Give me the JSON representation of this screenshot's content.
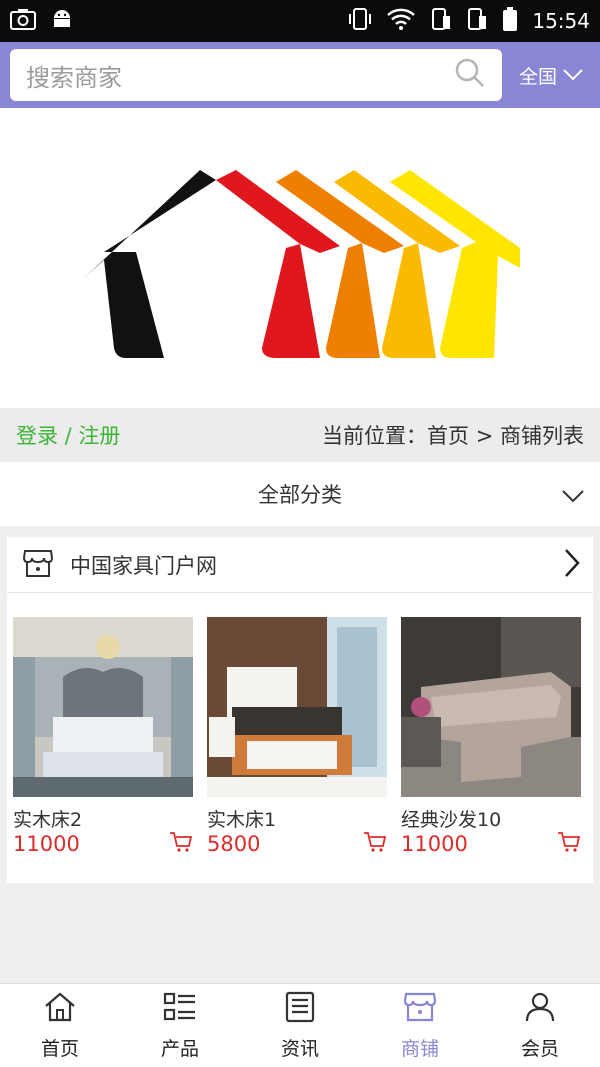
{
  "status_bar": {
    "time": "15:54"
  },
  "search": {
    "placeholder": "搜索商家",
    "region_label": "全国"
  },
  "location_bar": {
    "login_label": "登录 / 注册",
    "breadcrumb": "当前位置：首页 > 商铺列表"
  },
  "category": {
    "label": "全部分类"
  },
  "shop": {
    "name": "中国家具门户网",
    "products": [
      {
        "name": "实木床2",
        "price": "11000"
      },
      {
        "name": "实木床1",
        "price": "5800"
      },
      {
        "name": "经典沙发10",
        "price": "11000"
      }
    ]
  },
  "bottom_nav": {
    "items": [
      {
        "label": "首页",
        "icon": "home-icon"
      },
      {
        "label": "产品",
        "icon": "list-icon"
      },
      {
        "label": "资讯",
        "icon": "news-icon"
      },
      {
        "label": "商铺",
        "icon": "shop-icon",
        "active": true
      },
      {
        "label": "会员",
        "icon": "user-icon"
      }
    ]
  },
  "colors": {
    "accent": "#8a86d6",
    "login_green": "#3bb534",
    "price_red": "#e02b2b"
  }
}
